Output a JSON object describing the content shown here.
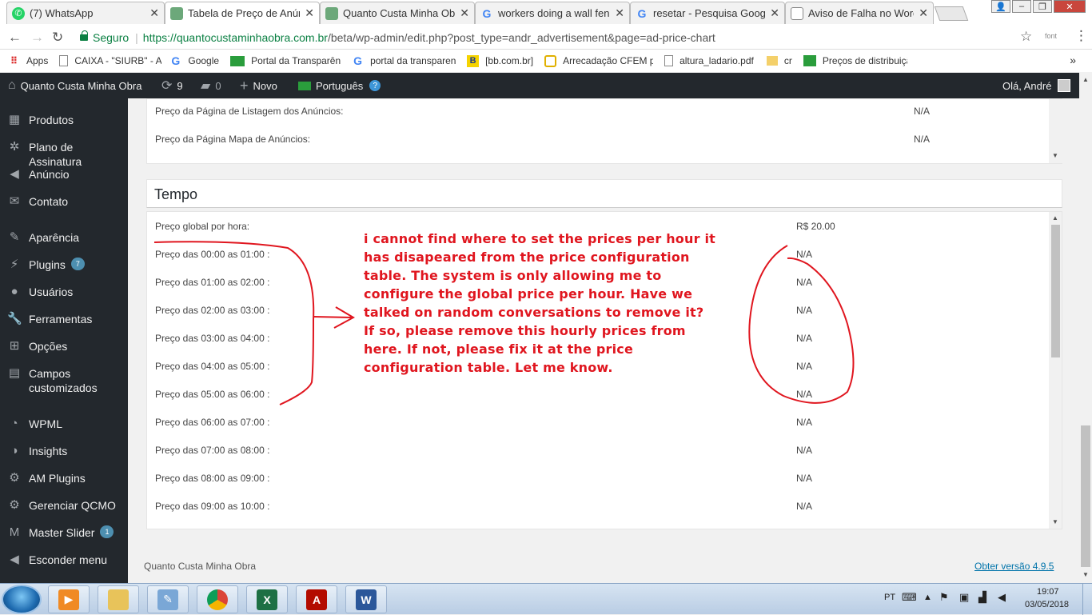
{
  "browser": {
    "tabs": [
      {
        "label": "(7) WhatsApp",
        "icon": "whatsapp-icon",
        "color": "#25d366"
      },
      {
        "label": "Tabela de Preço de Anún",
        "icon": "site-icon",
        "color": "#6ca87a"
      },
      {
        "label": "Quanto Custa Minha Obr",
        "icon": "site-icon",
        "color": "#6ca87a"
      },
      {
        "label": "workers doing a wall fenc",
        "icon": "google-icon",
        "color": "#4285f4"
      },
      {
        "label": "resetar - Pesquisa Google",
        "icon": "google-icon",
        "color": "#4285f4"
      },
      {
        "label": "Aviso de Falha no WordPr",
        "icon": "page-icon",
        "color": "#888888"
      }
    ],
    "secure_label": "Seguro",
    "url_host": "https://quantocustaminhaobra.com.br",
    "url_path": "/beta/wp-admin/edit.php?post_type=andr_advertisement&page=ad-price-chart",
    "font_ext": "font",
    "bookmarks": [
      {
        "label": "Apps",
        "icon": "apps-icon"
      },
      {
        "label": "CAIXA - \"SIURB\" - Ac",
        "icon": "page-icon"
      },
      {
        "label": "Google",
        "icon": "google-icon"
      },
      {
        "label": "Portal da Transparên",
        "icon": "flag-icon"
      },
      {
        "label": "portal da transparenc",
        "icon": "google-icon"
      },
      {
        "label": "[bb.com.br]",
        "icon": "bb-icon"
      },
      {
        "label": "Arrecadação CFEM p",
        "icon": "cfem-icon"
      },
      {
        "label": "altura_ladario.pdf",
        "icon": "page-icon"
      },
      {
        "label": "cr",
        "icon": "folder-icon"
      },
      {
        "label": "Preços de distribuiçã",
        "icon": "flag-icon"
      }
    ],
    "bookmarks_more": "»"
  },
  "adminbar": {
    "site": "Quanto Custa Minha Obra",
    "updates": "9",
    "comments": "0",
    "new": "Novo",
    "language": "Português",
    "greeting": "Olá, André"
  },
  "sidebar": [
    {
      "label": "Produtos",
      "icon": "grid-icon"
    },
    {
      "label": "Plano de Assinatura",
      "icon": "gear-person-icon"
    },
    {
      "label": "Anúncio",
      "icon": "megaphone-icon"
    },
    {
      "label": "Contato",
      "icon": "mail-icon"
    },
    {
      "label": "Aparência",
      "icon": "brush-icon"
    },
    {
      "label": "Plugins",
      "icon": "plug-icon",
      "badge": "7"
    },
    {
      "label": "Usuários",
      "icon": "user-icon"
    },
    {
      "label": "Ferramentas",
      "icon": "wrench-icon"
    },
    {
      "label": "Opções",
      "icon": "settings-icon"
    },
    {
      "label": "Campos customizados",
      "line1": "Campos",
      "line2": "customizados",
      "icon": "table-icon"
    },
    {
      "label": "WPML",
      "icon": "wpml-icon"
    },
    {
      "label": "Insights",
      "icon": "insights-icon"
    },
    {
      "label": "AM Plugins",
      "icon": "gear-icon"
    },
    {
      "label": "Gerenciar QCMO",
      "icon": "gear-icon"
    },
    {
      "label": "Master Slider",
      "icon": "slider-icon",
      "badge": "1"
    },
    {
      "label": "Esconder menu",
      "icon": "collapse-icon"
    }
  ],
  "top_panel": {
    "rows": [
      {
        "label": "Preço da Página de Listagem dos Anúncios:",
        "value": "N/A"
      },
      {
        "label": "Preço da Página Mapa de Anúncios:",
        "value": "N/A"
      }
    ]
  },
  "tempo": {
    "title": "Tempo",
    "rows": [
      {
        "label": "Preço global por hora:",
        "value": "R$ 20.00"
      },
      {
        "label": "Preço das 00:00 as 01:00 :",
        "value": "N/A"
      },
      {
        "label": "Preço das 01:00 as 02:00 :",
        "value": "N/A"
      },
      {
        "label": "Preço das 02:00 as 03:00 :",
        "value": "N/A"
      },
      {
        "label": "Preço das 03:00 as 04:00 :",
        "value": "N/A"
      },
      {
        "label": "Preço das 04:00 as 05:00 :",
        "value": "N/A"
      },
      {
        "label": "Preço das 05:00 as 06:00 :",
        "value": "N/A"
      },
      {
        "label": "Preço das 06:00 as 07:00 :",
        "value": "N/A"
      },
      {
        "label": "Preço das 07:00 as 08:00 :",
        "value": "N/A"
      },
      {
        "label": "Preço das 08:00 as 09:00 :",
        "value": "N/A"
      },
      {
        "label": "Preço das 09:00 as 10:00 :",
        "value": "N/A"
      }
    ]
  },
  "annotation": {
    "text": "i cannot find where to set the prices per hour it has disapeared from the price configuration table. The system is only allowing me to configure the global price per hour.  Have we talked on random conversations to remove it? If so, please remove this hourly prices from here. If not, please fix it at the price configuration table.    Let me know.",
    "color": "#e0161f"
  },
  "footer": {
    "left": "Quanto Custa Minha Obra",
    "right": "Obter versão 4.9.5"
  },
  "taskbar": {
    "language": "PT",
    "time": "19:07",
    "date": "03/05/2018"
  }
}
